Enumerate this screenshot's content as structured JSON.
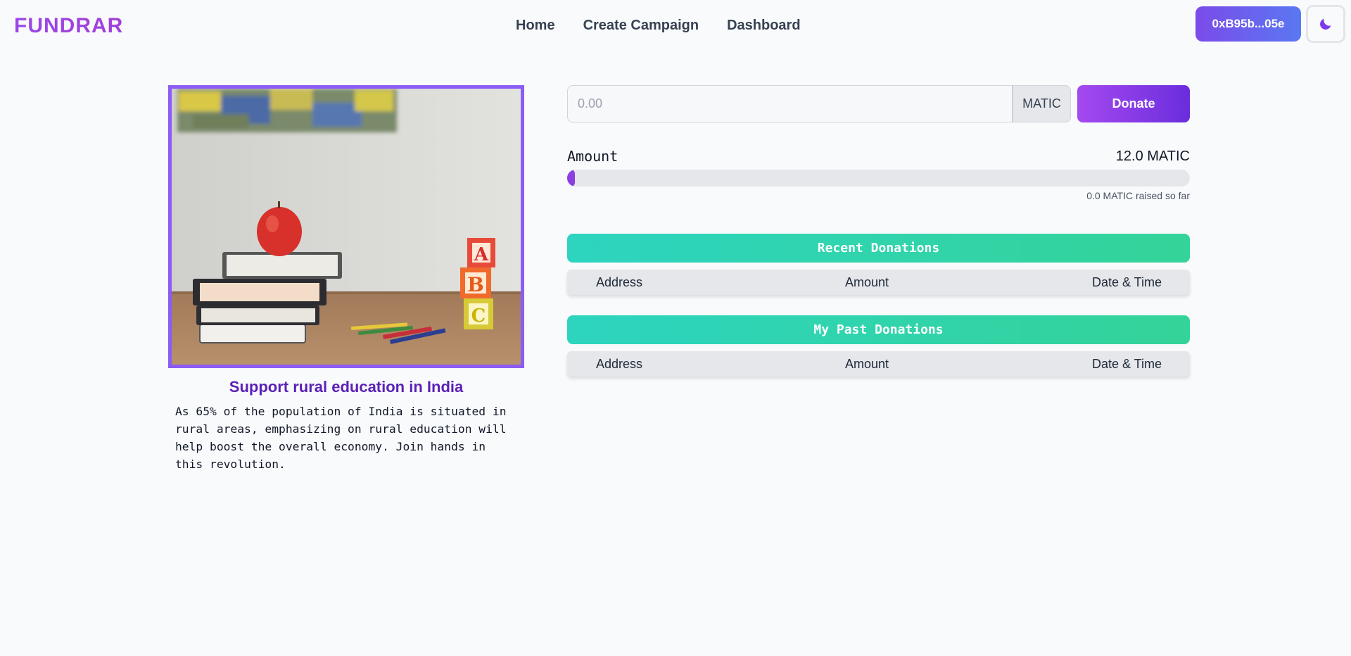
{
  "header": {
    "logo": "FUNDRAR",
    "nav": [
      "Home",
      "Create Campaign",
      "Dashboard"
    ],
    "wallet_address": "0xB95b...05e",
    "theme_icon": "moon-icon"
  },
  "campaign": {
    "title": "Support rural education in India",
    "description": "As 65% of the population of India is situated in rural areas, emphasizing on rural education will help boost the overall economy. Join hands in this revolution.",
    "image_alt": "stack of books with an apple, pencils and ABC blocks"
  },
  "donate": {
    "placeholder": "0.00",
    "unit": "MATIC",
    "button_label": "Donate"
  },
  "progress": {
    "label": "Amount",
    "goal": "12.0 MATIC",
    "raised_text": "0.0 MATIC raised so far",
    "fraction": 0.0
  },
  "recent_donations": {
    "title": "Recent Donations",
    "columns": [
      "Address",
      "Amount",
      "Date & Time"
    ]
  },
  "past_donations": {
    "title": "My Past Donations",
    "columns": [
      "Address",
      "Amount",
      "Date & Time"
    ]
  },
  "colors": {
    "accent": "#8b5cf6",
    "section_header": "#2dd4bf",
    "title": "#5b21b6"
  }
}
